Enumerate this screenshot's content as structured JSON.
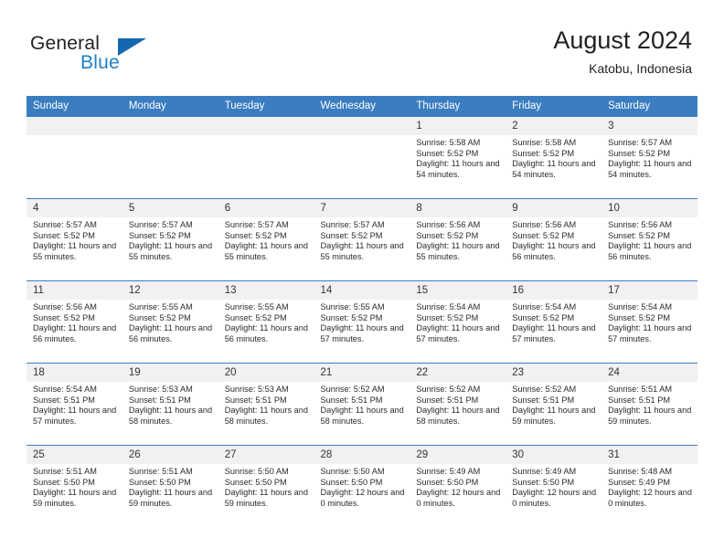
{
  "brand": {
    "name_part1": "General",
    "name_part2": "Blue",
    "logo_icon": "triangle-logo-icon"
  },
  "header": {
    "title": "August 2024",
    "location": "Katobu, Indonesia"
  },
  "theme": {
    "header_blue": "#3a7dc0",
    "brand_blue": "#1d7fc3",
    "daynum_band": "#f1f1f1",
    "text": "#2b2b2b"
  },
  "weekday_headers": [
    "Sunday",
    "Monday",
    "Tuesday",
    "Wednesday",
    "Thursday",
    "Friday",
    "Saturday"
  ],
  "weeks": [
    [
      {
        "day": "",
        "empty": true
      },
      {
        "day": "",
        "empty": true
      },
      {
        "day": "",
        "empty": true
      },
      {
        "day": "",
        "empty": true
      },
      {
        "day": "1",
        "sunrise": "Sunrise: 5:58 AM",
        "sunset": "Sunset: 5:52 PM",
        "daylight": "Daylight: 11 hours and 54 minutes."
      },
      {
        "day": "2",
        "sunrise": "Sunrise: 5:58 AM",
        "sunset": "Sunset: 5:52 PM",
        "daylight": "Daylight: 11 hours and 54 minutes."
      },
      {
        "day": "3",
        "sunrise": "Sunrise: 5:57 AM",
        "sunset": "Sunset: 5:52 PM",
        "daylight": "Daylight: 11 hours and 54 minutes."
      }
    ],
    [
      {
        "day": "4",
        "sunrise": "Sunrise: 5:57 AM",
        "sunset": "Sunset: 5:52 PM",
        "daylight": "Daylight: 11 hours and 55 minutes."
      },
      {
        "day": "5",
        "sunrise": "Sunrise: 5:57 AM",
        "sunset": "Sunset: 5:52 PM",
        "daylight": "Daylight: 11 hours and 55 minutes."
      },
      {
        "day": "6",
        "sunrise": "Sunrise: 5:57 AM",
        "sunset": "Sunset: 5:52 PM",
        "daylight": "Daylight: 11 hours and 55 minutes."
      },
      {
        "day": "7",
        "sunrise": "Sunrise: 5:57 AM",
        "sunset": "Sunset: 5:52 PM",
        "daylight": "Daylight: 11 hours and 55 minutes."
      },
      {
        "day": "8",
        "sunrise": "Sunrise: 5:56 AM",
        "sunset": "Sunset: 5:52 PM",
        "daylight": "Daylight: 11 hours and 55 minutes."
      },
      {
        "day": "9",
        "sunrise": "Sunrise: 5:56 AM",
        "sunset": "Sunset: 5:52 PM",
        "daylight": "Daylight: 11 hours and 56 minutes."
      },
      {
        "day": "10",
        "sunrise": "Sunrise: 5:56 AM",
        "sunset": "Sunset: 5:52 PM",
        "daylight": "Daylight: 11 hours and 56 minutes."
      }
    ],
    [
      {
        "day": "11",
        "sunrise": "Sunrise: 5:56 AM",
        "sunset": "Sunset: 5:52 PM",
        "daylight": "Daylight: 11 hours and 56 minutes."
      },
      {
        "day": "12",
        "sunrise": "Sunrise: 5:55 AM",
        "sunset": "Sunset: 5:52 PM",
        "daylight": "Daylight: 11 hours and 56 minutes."
      },
      {
        "day": "13",
        "sunrise": "Sunrise: 5:55 AM",
        "sunset": "Sunset: 5:52 PM",
        "daylight": "Daylight: 11 hours and 56 minutes."
      },
      {
        "day": "14",
        "sunrise": "Sunrise: 5:55 AM",
        "sunset": "Sunset: 5:52 PM",
        "daylight": "Daylight: 11 hours and 57 minutes."
      },
      {
        "day": "15",
        "sunrise": "Sunrise: 5:54 AM",
        "sunset": "Sunset: 5:52 PM",
        "daylight": "Daylight: 11 hours and 57 minutes."
      },
      {
        "day": "16",
        "sunrise": "Sunrise: 5:54 AM",
        "sunset": "Sunset: 5:52 PM",
        "daylight": "Daylight: 11 hours and 57 minutes."
      },
      {
        "day": "17",
        "sunrise": "Sunrise: 5:54 AM",
        "sunset": "Sunset: 5:52 PM",
        "daylight": "Daylight: 11 hours and 57 minutes."
      }
    ],
    [
      {
        "day": "18",
        "sunrise": "Sunrise: 5:54 AM",
        "sunset": "Sunset: 5:51 PM",
        "daylight": "Daylight: 11 hours and 57 minutes."
      },
      {
        "day": "19",
        "sunrise": "Sunrise: 5:53 AM",
        "sunset": "Sunset: 5:51 PM",
        "daylight": "Daylight: 11 hours and 58 minutes."
      },
      {
        "day": "20",
        "sunrise": "Sunrise: 5:53 AM",
        "sunset": "Sunset: 5:51 PM",
        "daylight": "Daylight: 11 hours and 58 minutes."
      },
      {
        "day": "21",
        "sunrise": "Sunrise: 5:52 AM",
        "sunset": "Sunset: 5:51 PM",
        "daylight": "Daylight: 11 hours and 58 minutes."
      },
      {
        "day": "22",
        "sunrise": "Sunrise: 5:52 AM",
        "sunset": "Sunset: 5:51 PM",
        "daylight": "Daylight: 11 hours and 58 minutes."
      },
      {
        "day": "23",
        "sunrise": "Sunrise: 5:52 AM",
        "sunset": "Sunset: 5:51 PM",
        "daylight": "Daylight: 11 hours and 59 minutes."
      },
      {
        "day": "24",
        "sunrise": "Sunrise: 5:51 AM",
        "sunset": "Sunset: 5:51 PM",
        "daylight": "Daylight: 11 hours and 59 minutes."
      }
    ],
    [
      {
        "day": "25",
        "sunrise": "Sunrise: 5:51 AM",
        "sunset": "Sunset: 5:50 PM",
        "daylight": "Daylight: 11 hours and 59 minutes."
      },
      {
        "day": "26",
        "sunrise": "Sunrise: 5:51 AM",
        "sunset": "Sunset: 5:50 PM",
        "daylight": "Daylight: 11 hours and 59 minutes."
      },
      {
        "day": "27",
        "sunrise": "Sunrise: 5:50 AM",
        "sunset": "Sunset: 5:50 PM",
        "daylight": "Daylight: 11 hours and 59 minutes."
      },
      {
        "day": "28",
        "sunrise": "Sunrise: 5:50 AM",
        "sunset": "Sunset: 5:50 PM",
        "daylight": "Daylight: 12 hours and 0 minutes."
      },
      {
        "day": "29",
        "sunrise": "Sunrise: 5:49 AM",
        "sunset": "Sunset: 5:50 PM",
        "daylight": "Daylight: 12 hours and 0 minutes."
      },
      {
        "day": "30",
        "sunrise": "Sunrise: 5:49 AM",
        "sunset": "Sunset: 5:50 PM",
        "daylight": "Daylight: 12 hours and 0 minutes."
      },
      {
        "day": "31",
        "sunrise": "Sunrise: 5:48 AM",
        "sunset": "Sunset: 5:49 PM",
        "daylight": "Daylight: 12 hours and 0 minutes."
      }
    ]
  ]
}
